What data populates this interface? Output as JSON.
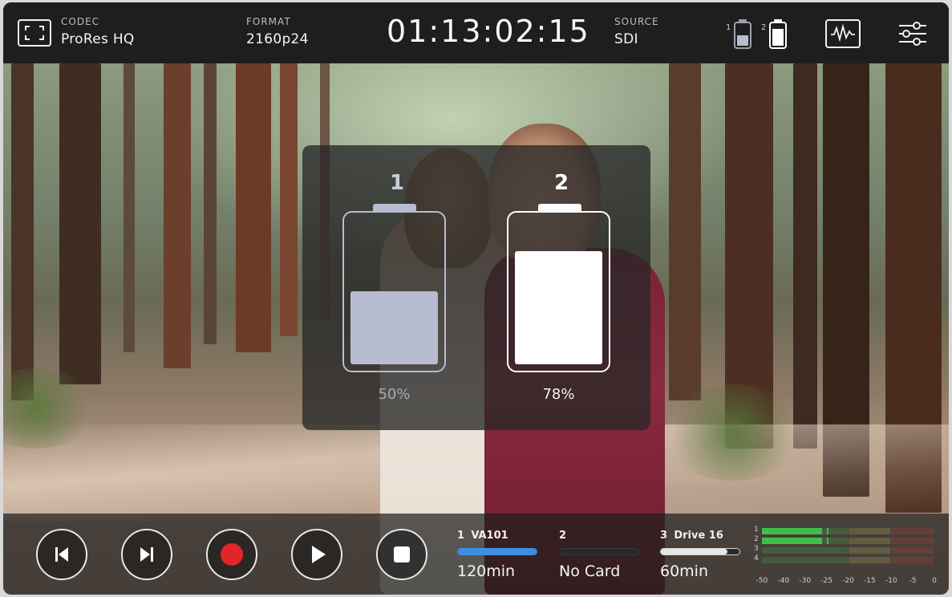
{
  "topbar": {
    "codec_label": "CODEC",
    "codec_value": "ProRes HQ",
    "format_label": "FORMAT",
    "format_value": "2160p24",
    "timecode": "01:13:02:15",
    "source_label": "SOURCE",
    "source_value": "SDI",
    "battery_1_num": "1",
    "battery_2_num": "2",
    "icons": [
      "fullscreen-frame-icon",
      "battery-1-icon",
      "battery-2-icon",
      "scopes-waveform-icon",
      "settings-sliders-icon"
    ]
  },
  "battery_overlay": {
    "battery_1": {
      "label": "1",
      "percent_text": "50%",
      "level": 0.5,
      "color": "#b8bcd0"
    },
    "battery_2": {
      "label": "2",
      "percent_text": "78%",
      "level": 0.78,
      "color": "#ffffff"
    }
  },
  "transport": {
    "icons": [
      "skip-previous-icon",
      "skip-next-icon",
      "record-icon",
      "play-icon",
      "stop-icon"
    ],
    "record_color": "#e0262b"
  },
  "slots": [
    {
      "number": "1",
      "name": "VA101",
      "value": "120min",
      "fill": 1.0,
      "bar_color": "#3d8fe6"
    },
    {
      "number": "2",
      "name": "",
      "value": "No Card",
      "fill": 0.0,
      "bar_color": "#555555"
    },
    {
      "number": "3",
      "name": "Drive 16",
      "value": "60min",
      "fill": 0.85,
      "bar_color": "#e6e6e6"
    }
  ],
  "audio_meters": {
    "channels": [
      "1",
      "2",
      "3",
      "4"
    ],
    "scale": [
      "-50",
      "-40",
      "-30",
      "-25",
      "-20",
      "-15",
      "-10",
      "-5",
      "0"
    ],
    "levels_db": [
      -26,
      -26,
      -60,
      -60
    ],
    "colors": {
      "green": "#3fbf4a",
      "yellow": "#c9c25a",
      "red": "#c23a3a"
    }
  }
}
